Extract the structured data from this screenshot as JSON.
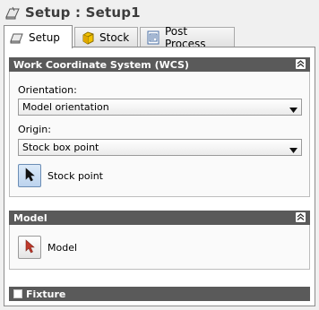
{
  "header": {
    "title": "Setup : Setup1",
    "icon": "setup-icon"
  },
  "tabs": [
    {
      "label": "Setup",
      "icon": "setup-icon",
      "active": true
    },
    {
      "label": "Stock",
      "icon": "stock-cube-icon",
      "active": false
    },
    {
      "label": "Post Process",
      "icon": "post-process-icon",
      "active": false
    }
  ],
  "wcs": {
    "title": "Work Coordinate System (WCS)",
    "orientation_label": "Orientation:",
    "orientation_value": "Model orientation",
    "origin_label": "Origin:",
    "origin_value": "Stock box point",
    "stock_point_label": "Stock point"
  },
  "model": {
    "title": "Model",
    "model_label": "Model"
  },
  "fixture": {
    "title": "Fixture"
  },
  "colors": {
    "section_header": "#5a5a5a",
    "accent_red": "#c0392b"
  }
}
